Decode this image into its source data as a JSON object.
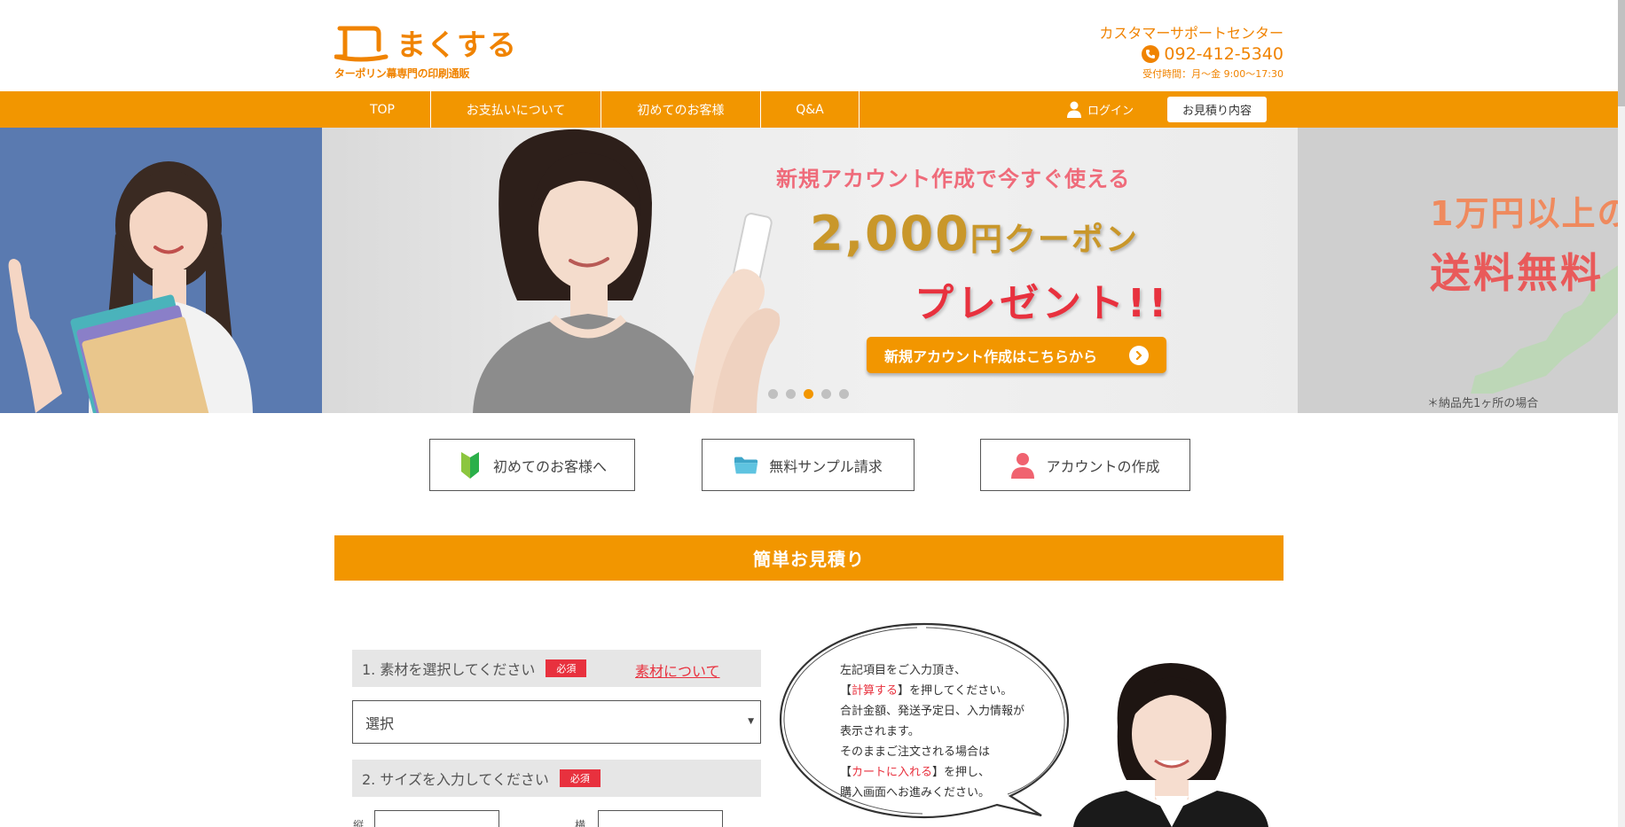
{
  "header": {
    "logo_name": "まくする",
    "logo_sub": "ターポリン幕専門の印刷通販",
    "support_title": "カスタマーサポートセンター",
    "support_phone": "092-412-5340",
    "support_hours": "受付時間：月〜金 9:00〜17:30"
  },
  "nav": {
    "items": [
      "TOP",
      "お支払いについて",
      "初めてのお客様",
      "Q&A"
    ],
    "login": "ログイン",
    "quote": "お見積り内容"
  },
  "hero": {
    "promo_line1": "新規アカウント作成で今すぐ使える",
    "promo_amount": "2,000",
    "promo_unit": "円クーポン",
    "promo_line3": "プレゼント!!",
    "promo_button": "新規アカウント作成はこちらから",
    "right_line1": "1万円以上の",
    "right_line2": "送料無料",
    "right_note": "＊納品先1ヶ所の場合",
    "dots_total": 5,
    "dots_active": 3
  },
  "quick_links": [
    {
      "label": "初めてのお客様へ",
      "icon": "beginner-mark-icon"
    },
    {
      "label": "無料サンプル請求",
      "icon": "folder-icon"
    },
    {
      "label": "アカウントの作成",
      "icon": "person-icon"
    }
  ],
  "estimate": {
    "title": "簡単お見積り",
    "step1_label": "1. 素材を選択してください",
    "step2_label": "2. サイズを入力してください",
    "required": "必須",
    "material_link": "素材について",
    "select_value": "選択",
    "width_label": "縦",
    "height_label": "横"
  },
  "bubble": {
    "l1": "左記項目をご入力頂き、",
    "l2_pre": "【",
    "l2_hl": "計算する",
    "l2_post": "】を押してください。",
    "l3": "合計金額、発送予定日、入力情報が",
    "l4": "表示されます。",
    "l5": "そのままご注文される場合は",
    "l6_pre": "【",
    "l6_hl": "カートに入れる",
    "l6_post": "】を押し、",
    "l7": "購入画面へお進みください。"
  },
  "colors": {
    "brand_orange": "#f29600",
    "accent_red": "#e8313e",
    "text": "#333333"
  }
}
